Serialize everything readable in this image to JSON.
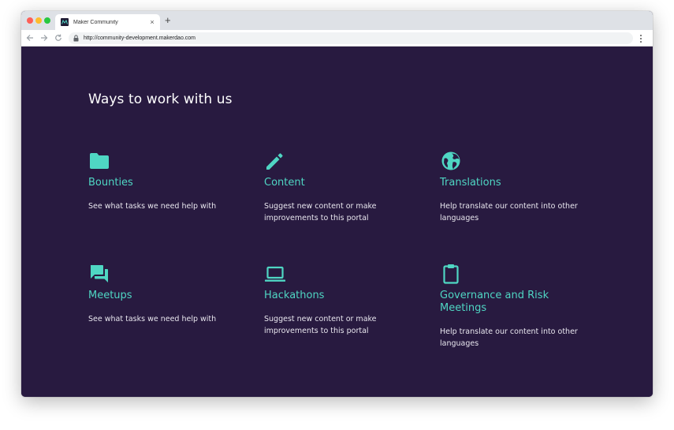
{
  "browser": {
    "tab_title": "Maker Community",
    "tab_close": "×",
    "new_tab": "+",
    "url": "http://community-development.makerdao.com"
  },
  "page": {
    "heading": "Ways to work with us",
    "accent_color": "#4fd6c3",
    "background_color": "#281a40",
    "cards": [
      {
        "icon": "folder-icon",
        "title": "Bounties",
        "description": "See what tasks we need help with"
      },
      {
        "icon": "pencil-icon",
        "title": "Content",
        "description": "Suggest new content or make improvements to this portal"
      },
      {
        "icon": "globe-icon",
        "title": "Translations",
        "description": "Help translate our content into other languages"
      },
      {
        "icon": "chat-bubbles-icon",
        "title": "Meetups",
        "description": "See what tasks we need help with"
      },
      {
        "icon": "laptop-icon",
        "title": "Hackathons",
        "description": "Suggest new content or make improvements to this portal"
      },
      {
        "icon": "clipboard-icon",
        "title": "Governance and Risk Meetings",
        "description": "Help translate our content into other languages"
      }
    ]
  }
}
